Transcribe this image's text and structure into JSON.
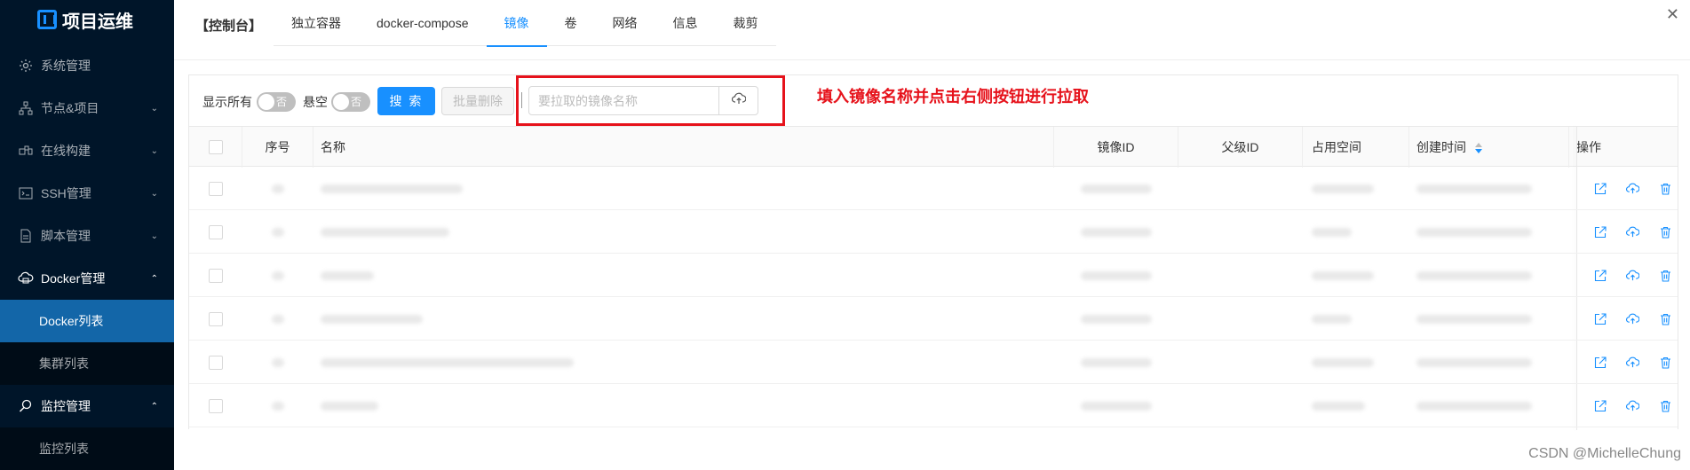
{
  "sidebar": {
    "logo_text": "项目运维",
    "items": [
      {
        "label": "系统管理",
        "icon": "gear-icon"
      },
      {
        "label": "节点&项目",
        "icon": "sitemap-icon"
      },
      {
        "label": "在线构建",
        "icon": "build-icon"
      },
      {
        "label": "SSH管理",
        "icon": "terminal-icon"
      },
      {
        "label": "脚本管理",
        "icon": "file-icon"
      },
      {
        "label": "Docker管理",
        "icon": "cloud-server-icon"
      },
      {
        "label": "Docker列表"
      },
      {
        "label": "集群列表"
      },
      {
        "label": "监控管理",
        "icon": "monitor-search-icon"
      },
      {
        "label": "监控列表"
      }
    ]
  },
  "header": {
    "console_label": "【控制台】",
    "tabs": [
      "独立容器",
      "docker-compose",
      "镜像",
      "卷",
      "网络",
      "信息",
      "裁剪"
    ],
    "active_tab": "镜像",
    "close_icon": "close-icon"
  },
  "toolbar": {
    "show_all_label": "显示所有",
    "show_all_switch": "否",
    "dangling_label": "悬空",
    "dangling_switch": "否",
    "search_label": "搜 索",
    "batch_delete_label": "批量删除",
    "pull_placeholder": "要拉取的镜像名称",
    "pull_icon": "cloud-upload-icon"
  },
  "annotation": "填入镜像名称并点击右侧按钮进行拉取",
  "table": {
    "columns": [
      "序号",
      "名称",
      "镜像ID",
      "父级ID",
      "占用空间",
      "创建时间",
      "操作"
    ],
    "row_count": 6,
    "row_actions": [
      "export-icon",
      "cloud-upload-icon",
      "delete-icon"
    ]
  },
  "colors": {
    "sidebar_bg": "#001529",
    "accent": "#1890ff",
    "annotation_red": "#e6121b"
  },
  "watermark": "CSDN @MichelleChung"
}
